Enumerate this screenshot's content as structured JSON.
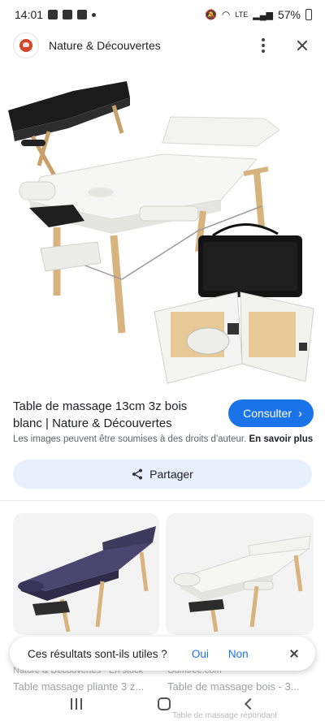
{
  "status_bar": {
    "time": "14:01",
    "battery": "57%",
    "network": "LTE"
  },
  "header": {
    "site_name": "Nature & Découvertes",
    "icons": [
      "site-logo",
      "more-vert-icon",
      "close-icon"
    ]
  },
  "result": {
    "title": "Table de massage 13cm 3z bois blanc | Nature & Découvertes",
    "consult_label": "Consulter",
    "copyright_notice": "Les images peuvent être soumises à des droits d'auteur.",
    "learn_more": "En savoir plus",
    "share_label": "Partager"
  },
  "related": [
    {
      "source": "Nature & Découvertes · En stock",
      "title": "Table massage pliante 3 z..."
    },
    {
      "source": "Gumtree.com",
      "title": "Table de massage bois - 3..."
    }
  ],
  "bottom_hint": "Table de massage répondant",
  "feedback": {
    "question": "Ces résultats sont-ils utiles ?",
    "yes": "Oui",
    "no": "Non"
  },
  "colors": {
    "accent": "#1a73e8",
    "share_bg": "#e8f0fe"
  }
}
